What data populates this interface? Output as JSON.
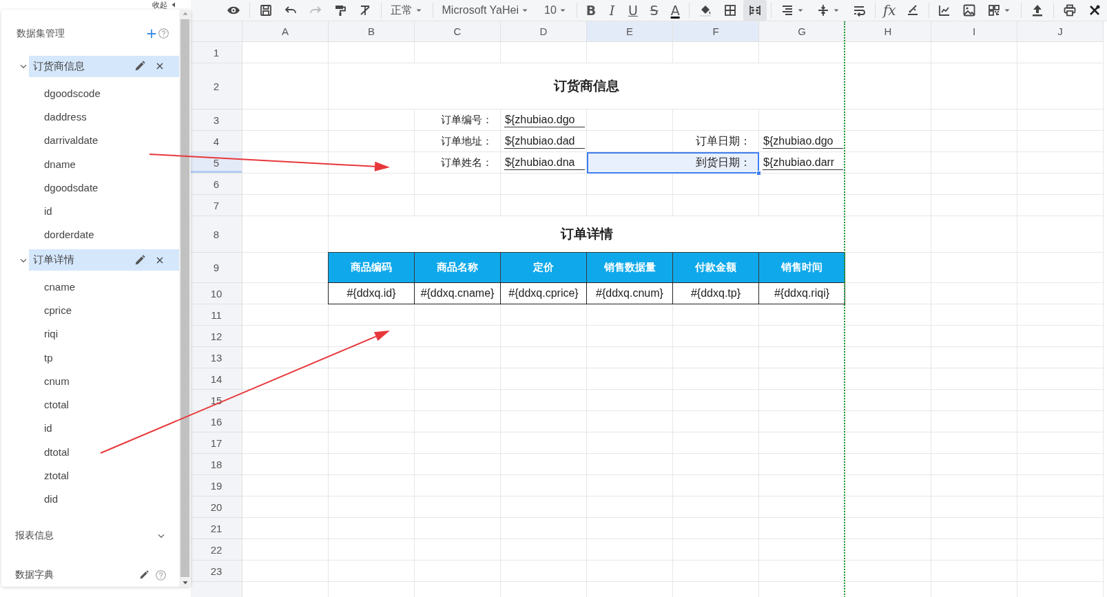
{
  "collapse_button": {
    "label": "收起"
  },
  "sidebar": {
    "title": "数据集管理",
    "datasets": [
      {
        "name": "订货商信息",
        "expanded": true,
        "selected": true,
        "fields": [
          "dgoodscode",
          "daddress",
          "darrivaldate",
          "dname",
          "dgoodsdate",
          "id",
          "dorderdate"
        ]
      },
      {
        "name": "订单详情",
        "expanded": true,
        "selected": true,
        "fields": [
          "cname",
          "cprice",
          "riqi",
          "tp",
          "cnum",
          "ctotal",
          "id",
          "dtotal",
          "ztotal",
          "did"
        ]
      }
    ],
    "sections": [
      {
        "label": "报表信息",
        "kind": "collapsible"
      },
      {
        "label": "数据字典",
        "kind": "editable"
      }
    ]
  },
  "toolbar": {
    "style": "正常",
    "font": "Microsoft YaHei",
    "size": "10",
    "format_buttons": [
      "B",
      "I",
      "U",
      "S",
      "A"
    ],
    "formula_button": "fx",
    "merge_cells_on": true
  },
  "sheet": {
    "columns": [
      {
        "label": "A",
        "selected": false
      },
      {
        "label": "B",
        "selected": false
      },
      {
        "label": "C",
        "selected": false
      },
      {
        "label": "D",
        "selected": false
      },
      {
        "label": "E",
        "selected": true
      },
      {
        "label": "F",
        "selected": true
      },
      {
        "label": "G",
        "selected": false
      },
      {
        "label": "H",
        "selected": false
      },
      {
        "label": "I",
        "selected": false
      },
      {
        "label": "J",
        "selected": false
      }
    ],
    "rows": [
      {
        "label": "1",
        "selected": false,
        "cells": []
      },
      {
        "label": "2",
        "selected": false,
        "cells": [
          {
            "kind": "empty"
          },
          {
            "kind": "title",
            "text": "订货商信息",
            "selected": false
          }
        ]
      },
      {
        "label": "3",
        "selected": false,
        "cells": [
          {
            "kind": "empty"
          },
          {
            "kind": "empty"
          },
          {
            "kind": "label",
            "text": "订单编号：",
            "selected": false
          },
          {
            "kind": "field",
            "text": "${zhubiao.dgo",
            "selected": false
          }
        ]
      },
      {
        "label": "4",
        "selected": false,
        "cells": [
          {
            "kind": "empty"
          },
          {
            "kind": "empty"
          },
          {
            "kind": "label",
            "text": "订单地址：",
            "selected": false
          },
          {
            "kind": "field",
            "text": "${zhubiao.dad",
            "selected": false
          },
          {
            "kind": "wide_label",
            "text": "订单日期：",
            "selected": false
          },
          {
            "kind": "field",
            "text": "${zhubiao.dgo",
            "selected": false
          }
        ]
      },
      {
        "label": "5",
        "selected": true,
        "cells": [
          {
            "kind": "empty"
          },
          {
            "kind": "empty"
          },
          {
            "kind": "label",
            "text": "订单姓名：",
            "selected": false
          },
          {
            "kind": "field",
            "text": "${zhubiao.dna",
            "selected": false
          },
          {
            "kind": "wide_label",
            "text": "到货日期：",
            "selected": true
          },
          {
            "kind": "field",
            "text": "${zhubiao.darr",
            "selected": false
          }
        ]
      },
      {
        "label": "6",
        "selected": false,
        "cells": []
      },
      {
        "label": "7",
        "selected": false,
        "cells": []
      },
      {
        "label": "8",
        "selected": false,
        "cells": [
          {
            "kind": "empty"
          },
          {
            "kind": "title",
            "text": "订单详情",
            "selected": false
          }
        ]
      },
      {
        "label": "9",
        "selected": false,
        "cells": [
          {
            "kind": "empty"
          },
          {
            "kind": "header",
            "text": "商品编码",
            "selected": false
          },
          {
            "kind": "header",
            "text": "商品名称",
            "selected": false
          },
          {
            "kind": "header",
            "text": "定价",
            "selected": false
          },
          {
            "kind": "header",
            "text": "销售数据量",
            "selected": false
          },
          {
            "kind": "header",
            "text": "付款金额",
            "selected": false
          },
          {
            "kind": "header",
            "text": "销售时间",
            "selected": false
          }
        ]
      },
      {
        "label": "10",
        "selected": false,
        "cells": [
          {
            "kind": "empty"
          },
          {
            "kind": "data",
            "text": "#{ddxq.id}",
            "selected": false
          },
          {
            "kind": "data",
            "text": "#{ddxq.cname}",
            "selected": false
          },
          {
            "kind": "data",
            "text": "#{ddxq.cprice}",
            "selected": false
          },
          {
            "kind": "data",
            "text": "#{ddxq.cnum}",
            "selected": false
          },
          {
            "kind": "data",
            "text": "#{ddxq.tp}",
            "selected": false
          },
          {
            "kind": "data",
            "text": "#{ddxq.riqi}",
            "selected": false
          }
        ]
      },
      {
        "label": "11",
        "selected": false,
        "cells": []
      },
      {
        "label": "12",
        "selected": false,
        "cells": []
      },
      {
        "label": "13",
        "selected": false,
        "cells": []
      },
      {
        "label": "14",
        "selected": false,
        "cells": []
      },
      {
        "label": "15",
        "selected": false,
        "cells": []
      },
      {
        "label": "16",
        "selected": false,
        "cells": []
      },
      {
        "label": "17",
        "selected": false,
        "cells": []
      },
      {
        "label": "18",
        "selected": false,
        "cells": []
      },
      {
        "label": "19",
        "selected": false,
        "cells": []
      },
      {
        "label": "20",
        "selected": false,
        "cells": []
      },
      {
        "label": "21",
        "selected": false,
        "cells": []
      },
      {
        "label": "22",
        "selected": false,
        "cells": []
      },
      {
        "label": "23",
        "selected": false,
        "cells": []
      }
    ]
  }
}
